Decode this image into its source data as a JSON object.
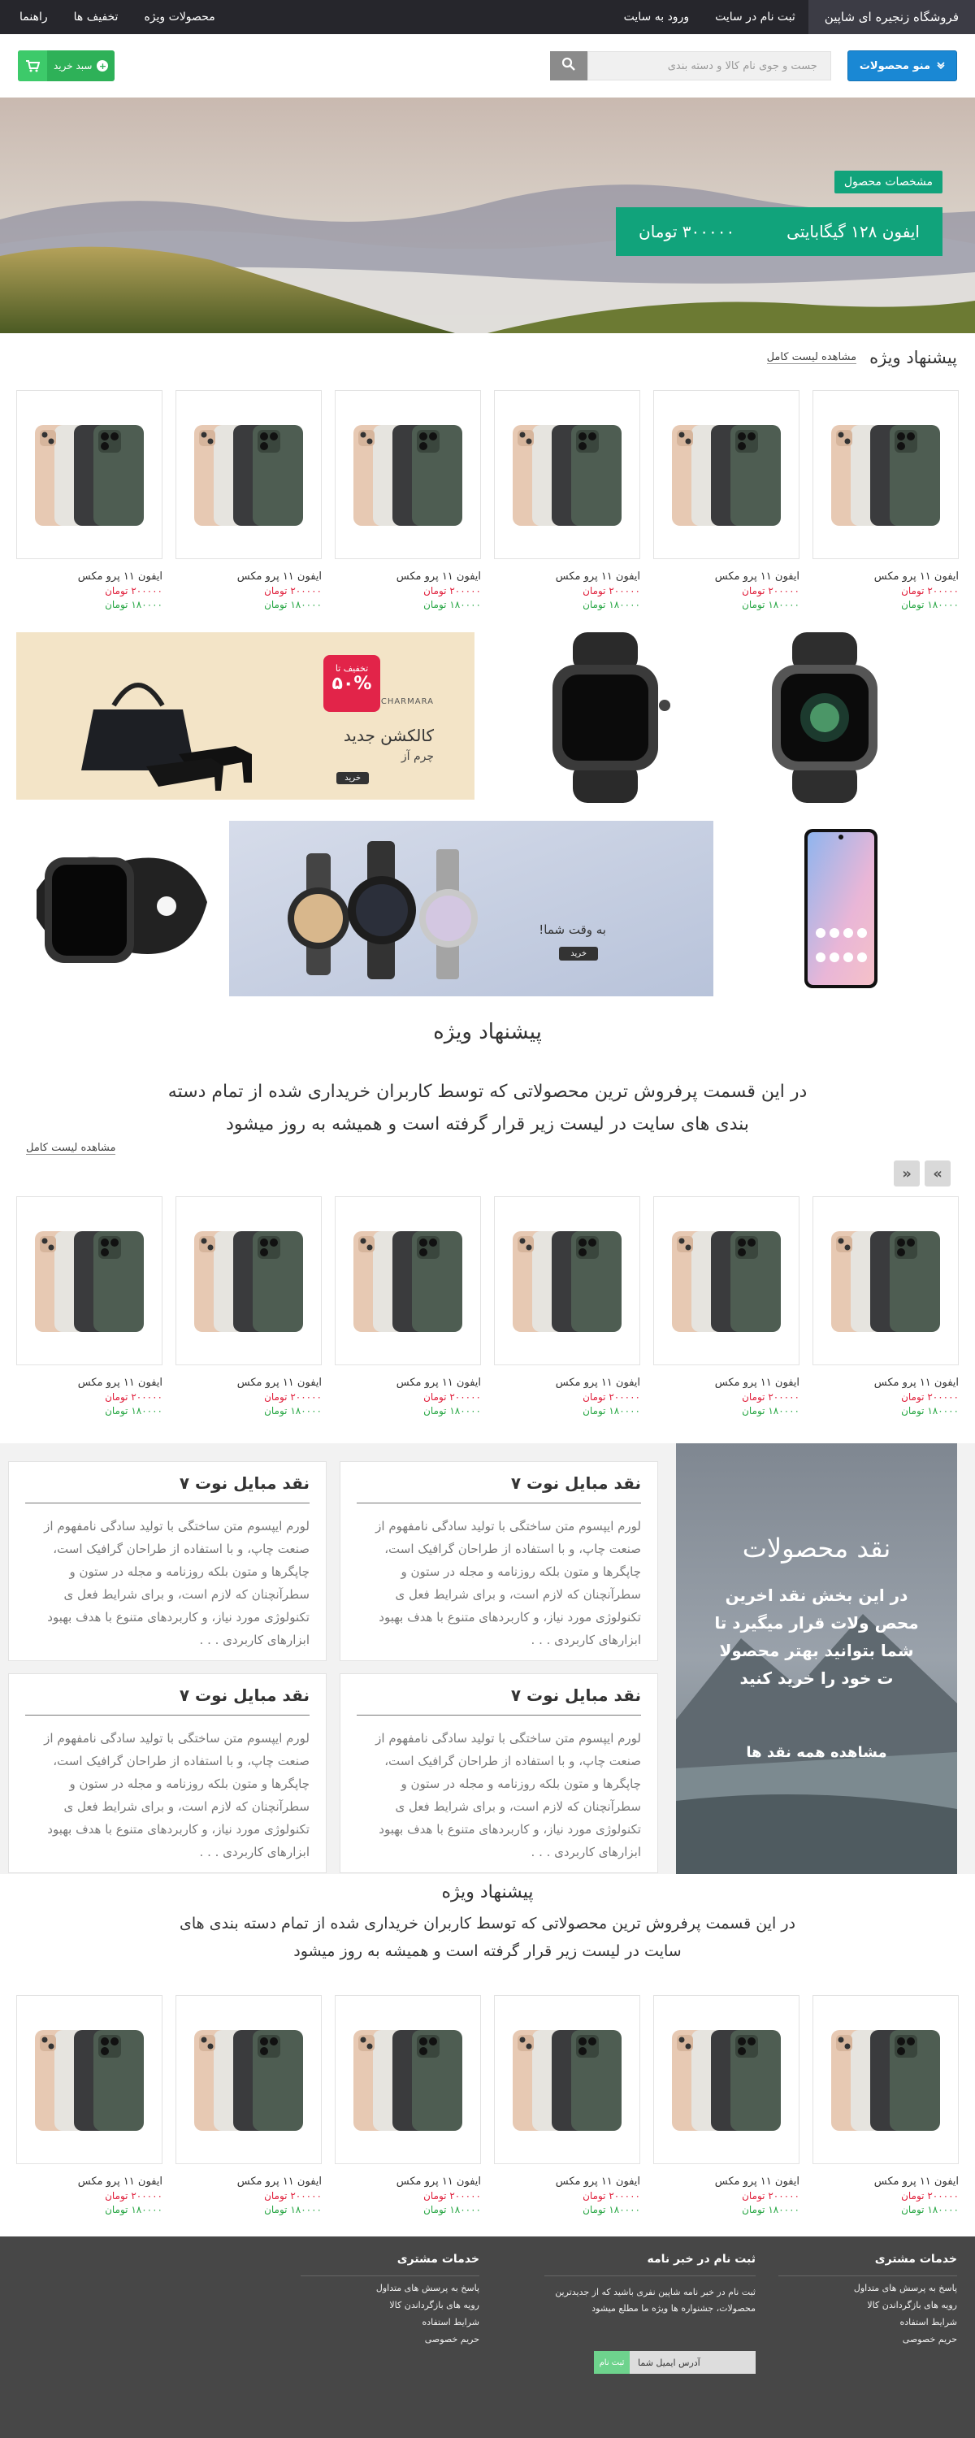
{
  "topnav": {
    "brand": "فروشگاه زنجیره ای شاپین",
    "register": "ثبت نام در سایت",
    "login": "ورود به سایت",
    "products": "محصولات ویژه",
    "discounts": "تخفیف ها",
    "guide": "راهنما"
  },
  "header": {
    "menu_label": "منو محصولات",
    "search_placeholder": "جست و جوی نام کالا و دسته بندی",
    "cart_label": "سبد خرید"
  },
  "hero": {
    "tag": "مشخصات محصول",
    "product": "ایفون ۱۲۸ گیگابایتی",
    "price": "۳۰۰۰۰۰ تومان"
  },
  "section1": {
    "title": "پیشنهاد ویژه",
    "more": "مشاهده لیست کامل"
  },
  "section2": {
    "title": "پیشنهاد ویژه",
    "desc": "در این قسمت پرفروش ترین محصولاتی که توسط کاربران خریداری شده از تمام دسته بندی های سایت در لیست زیر قرار گرفته است و همیشه به روز میشود",
    "more": "مشاهده لیست کامل",
    "next": "»",
    "prev": "«"
  },
  "section3": {
    "title": "پیشنهاد ویژه",
    "desc": "در این قسمت پرفروش ترین محصولاتی که توسط کاربران خریداری شده از تمام دسته بندی های سایت در لیست زیر قرار گرفته است و همیشه به روز میشود"
  },
  "product": {
    "name": "ایفون ۱۱ پرو مکس",
    "old_price": "۲۰۰۰۰۰ تومان",
    "new_price": "۱۸۰۰۰۰ تومان"
  },
  "banners": {
    "discount_top": "تخفیف تا",
    "discount_pct": "۵۰%",
    "brand": "CHARMARA",
    "collection": "کالکشن جدید",
    "leather": "چرم آز",
    "buy": "خرید",
    "watch_text": "به وقت شما!",
    "watch_buy": "خرید"
  },
  "reviews": {
    "hero_title": "نقد محصولات",
    "hero_desc": "در این بخش نقد اخرین محص ولات قرار میگیرد تا شما بتوانید بهتر محصولا ت خود را خرید کنید",
    "hero_all": "مشاهده همه نقد ها",
    "card_title": "نقد مبایل نوت ۷",
    "card_body": "لورم ایپسوم متن ساختگی با تولید سادگی نامفهوم از صنعت چاپ، و با استفاده از طراحان گرافیک است، چاپگرها و متون بلکه روزنامه و مجله در ستون و سطرآنچنان که لازم است، و برای شرایط فعل ی تکنولوژی مورد نیاز، و کاربردهای متنوع با هدف بهبود ابزارهای کاربردی . . ."
  },
  "footer": {
    "col1_title": "خدمات مشتری",
    "col1_items": [
      "پاسخ به پرسش های متداول",
      "رویه های بازگرداندن کالا",
      "شرایط استفاده",
      "حریم خصوصی"
    ],
    "news_title": "ثبت نام در خبر نامه",
    "news_text": "ثبت نام در خبر نامه شاپین نفری باشید که از جدیدترین محصولات، جشنواره ها ویژه ما مطلع میشود",
    "news_placeholder": "آدرس ایمیل شما",
    "news_button": "ثبت نام",
    "col3_title": "خدمات مشتری",
    "col3_items": [
      "پاسخ به پرسش های متداول",
      "رویه های بازگرداندن کالا",
      "شرایط استفاده",
      "حریم خصوصی"
    ]
  },
  "colors": {
    "nav": "#26262c",
    "accent_blue": "#1a88d4",
    "accent_green": "#11a37b",
    "price_red": "#e0203c",
    "price_green": "#28a745",
    "footer": "#474747"
  }
}
